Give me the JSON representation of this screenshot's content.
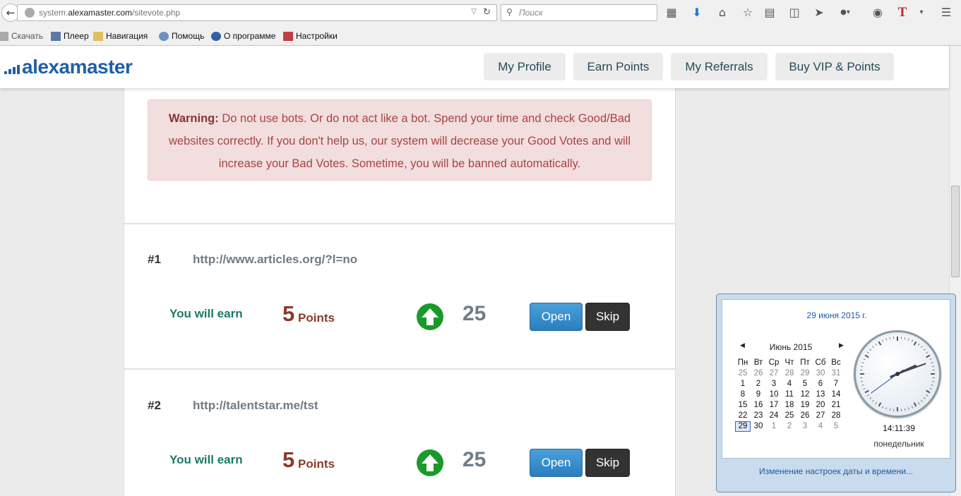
{
  "browser": {
    "url_prefix": "system.",
    "url_domain": "alexamaster.com",
    "url_path": "/sitevote.php",
    "search_placeholder": "Поиск",
    "bookmarks": [
      "Скачать",
      "Плеер",
      "Навигация",
      "Помощь",
      "О программе",
      "Настройки"
    ]
  },
  "site": {
    "logo": "alexamaster",
    "nav": [
      "My Profile",
      "Earn Points",
      "My Referrals",
      "Buy VIP & Points"
    ]
  },
  "warning": {
    "label": "Warning:",
    "text": "Do not use bots. Or do not act like a bot. Spend your time and check Good/Bad websites correctly. If you don't help us, our system will decrease your Good Votes and will increase your Bad Votes. Sometime, you will be banned automatically."
  },
  "sites": [
    {
      "num": "#1",
      "url": "http://www.articles.org/?l=no",
      "earn_label": "You will earn",
      "points": "5",
      "points_label": "Points",
      "votes": "25",
      "open": "Open",
      "skip": "Skip"
    },
    {
      "num": "#2",
      "url": "http://talentstar.me/tst",
      "earn_label": "You will earn",
      "points": "5",
      "points_label": "Points",
      "votes": "25",
      "open": "Open",
      "skip": "Skip"
    }
  ],
  "calendar": {
    "full_date": "29 июня 2015 г.",
    "month": "Июнь 2015",
    "weekdays": [
      "Пн",
      "Вт",
      "Ср",
      "Чт",
      "Пт",
      "Сб",
      "Вс"
    ],
    "weeks": [
      [
        "25",
        "26",
        "27",
        "28",
        "29",
        "30",
        "31"
      ],
      [
        "1",
        "2",
        "3",
        "4",
        "5",
        "6",
        "7"
      ],
      [
        "8",
        "9",
        "10",
        "11",
        "12",
        "13",
        "14"
      ],
      [
        "15",
        "16",
        "17",
        "18",
        "19",
        "20",
        "21"
      ],
      [
        "22",
        "23",
        "24",
        "25",
        "26",
        "27",
        "28"
      ],
      [
        "29",
        "30",
        "1",
        "2",
        "3",
        "4",
        "5"
      ]
    ],
    "time": "14:11:39",
    "weekday": "понедельник",
    "footer_link": "Изменение настроек даты и времени..."
  }
}
